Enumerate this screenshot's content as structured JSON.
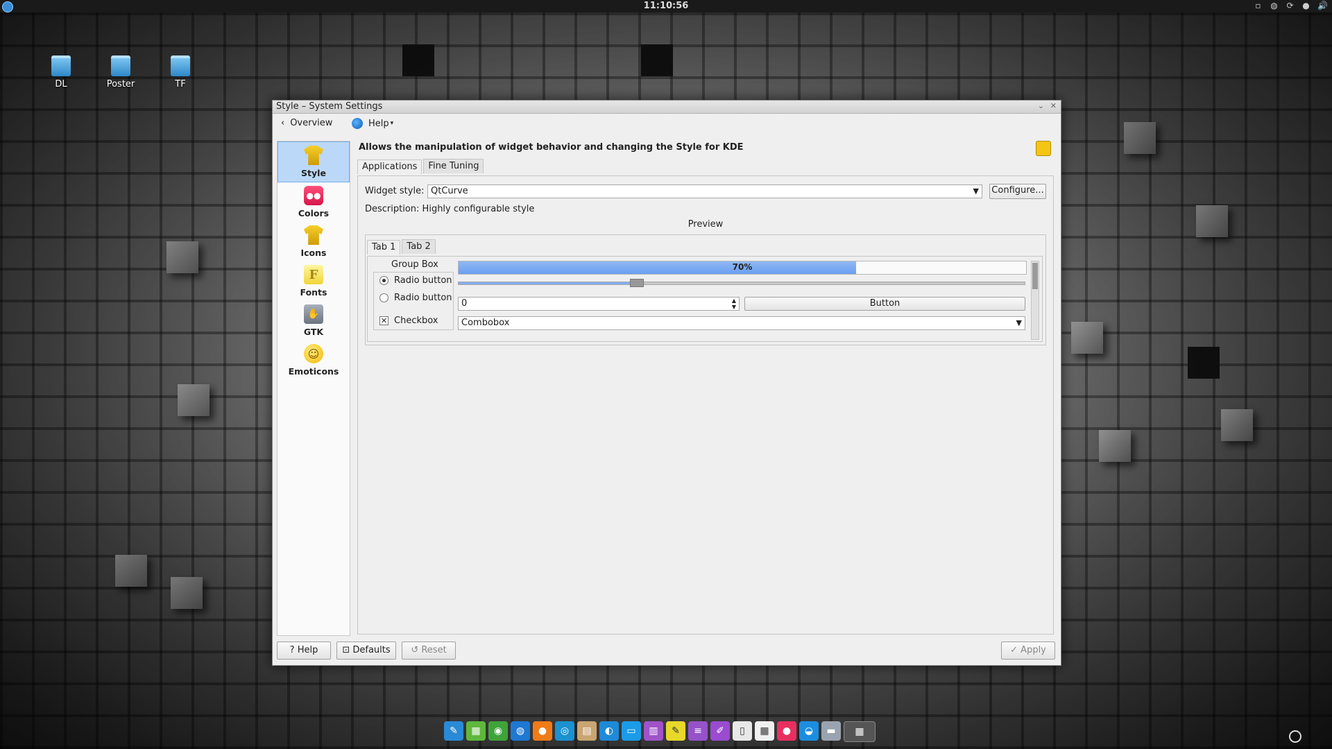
{
  "panel": {
    "clock": "11:10:56"
  },
  "desktop": {
    "icons": [
      {
        "label": "DL"
      },
      {
        "label": "Poster"
      },
      {
        "label": "TF"
      }
    ]
  },
  "window": {
    "title": "Style – System Settings",
    "toolbar": {
      "back_label": "Overview",
      "help_label": "Help"
    },
    "sidebar": {
      "items": [
        {
          "label": "Style",
          "icon": "shirt-icon"
        },
        {
          "label": "Colors",
          "icon": "colors-icon"
        },
        {
          "label": "Icons",
          "icon": "shirt-icon"
        },
        {
          "label": "Fonts",
          "icon": "fonts-icon",
          "glyph": "F"
        },
        {
          "label": "GTK",
          "icon": "gtk-icon"
        },
        {
          "label": "Emoticons",
          "icon": "emoticon-icon"
        }
      ]
    },
    "description": "Allows the manipulation of widget behavior and changing the Style for KDE",
    "tabs": [
      {
        "label": "Applications"
      },
      {
        "label": "Fine Tuning"
      }
    ],
    "widget_style": {
      "label": "Widget style:",
      "value": "QtCurve",
      "configure_label": "Configure...",
      "description": "Description: Highly configurable style"
    },
    "preview": {
      "title": "Preview",
      "tabs": [
        {
          "label": "Tab 1"
        },
        {
          "label": "Tab 2"
        }
      ],
      "group_box": "Group Box",
      "radio1": "Radio button",
      "radio2": "Radio button",
      "checkbox": "Checkbox",
      "progress_text": "70%",
      "progress_value": 0.7,
      "slider_value": 0.31,
      "spin_value": "0",
      "button": "Button",
      "combobox": "Combobox"
    },
    "buttons": {
      "help": "Help",
      "defaults": "Defaults",
      "reset": "Reset",
      "apply": "Apply"
    }
  },
  "colors": {
    "selection": "#bcd8f8",
    "progress": "#7aa8f2",
    "accent": "#3a8fd9"
  }
}
